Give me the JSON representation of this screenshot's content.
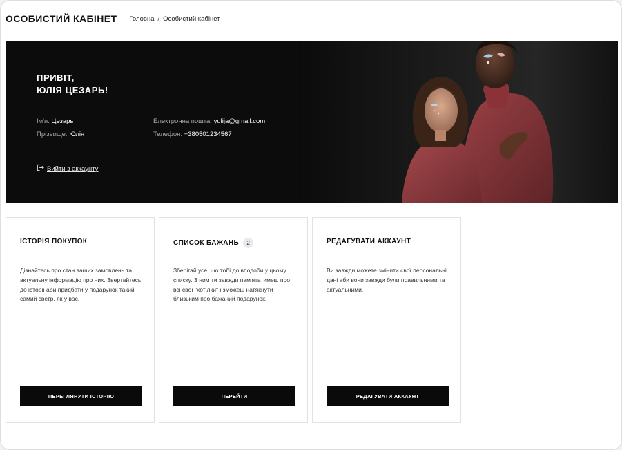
{
  "header": {
    "title": "ОСОБИСТИЙ КАБІНЕТ",
    "breadcrumb": {
      "home": "Головна",
      "separator": "/",
      "current": "Особистий кабінет"
    }
  },
  "hero": {
    "greeting_line1": "ПРИВІТ,",
    "greeting_line2": "ЮЛІЯ ЦЕЗАРЬ!",
    "first_name_label": "Ім'я:",
    "first_name_value": "Цезарь",
    "last_name_label": "Прізвище:",
    "last_name_value": "Юлія",
    "email_label": "Електронна пошта:",
    "email_value": "yulija@gmail.com",
    "phone_label": "Телефон:",
    "phone_value": "+380501234567",
    "logout_icon": "logout-icon",
    "logout_label": "Вийти з аккаунту",
    "photo": "couple-photo"
  },
  "cards": [
    {
      "title": "ІСТОРІЯ ПОКУПОК",
      "text": "Дізнайтесь про стан ваших замовлень та актуальну інформацію про них. Звертайтесь до історії аби придбати у подарунок такий самий светр, як у вас.",
      "button": "ПЕРЕГЛЯНУТИ ІСТОРІЮ"
    },
    {
      "title": "СПИСОК БАЖАНЬ",
      "badge": "2",
      "text": "Зберігай усе, що тобі до вподоби у цьому списку. З ним ти завжди пам'ятатимеш про всі свої \"хотілки\" і зможеш натякнути близьким про бажаний подарунок.",
      "button": "ПЕРЕЙТИ"
    },
    {
      "title": "РЕДАГУВАТИ АККАУНТ",
      "text": "Ви завжди можете змінити свої персональні дані аби вони завжди були правильними та актуальними.",
      "button": "РЕДАГУВАТИ АККАУНТ"
    }
  ],
  "colors": {
    "hero_background": "#0c0c0c",
    "button_background": "#0a0a0a",
    "sweater": "#8e3a3e",
    "card_border": "#e2e2e2"
  }
}
